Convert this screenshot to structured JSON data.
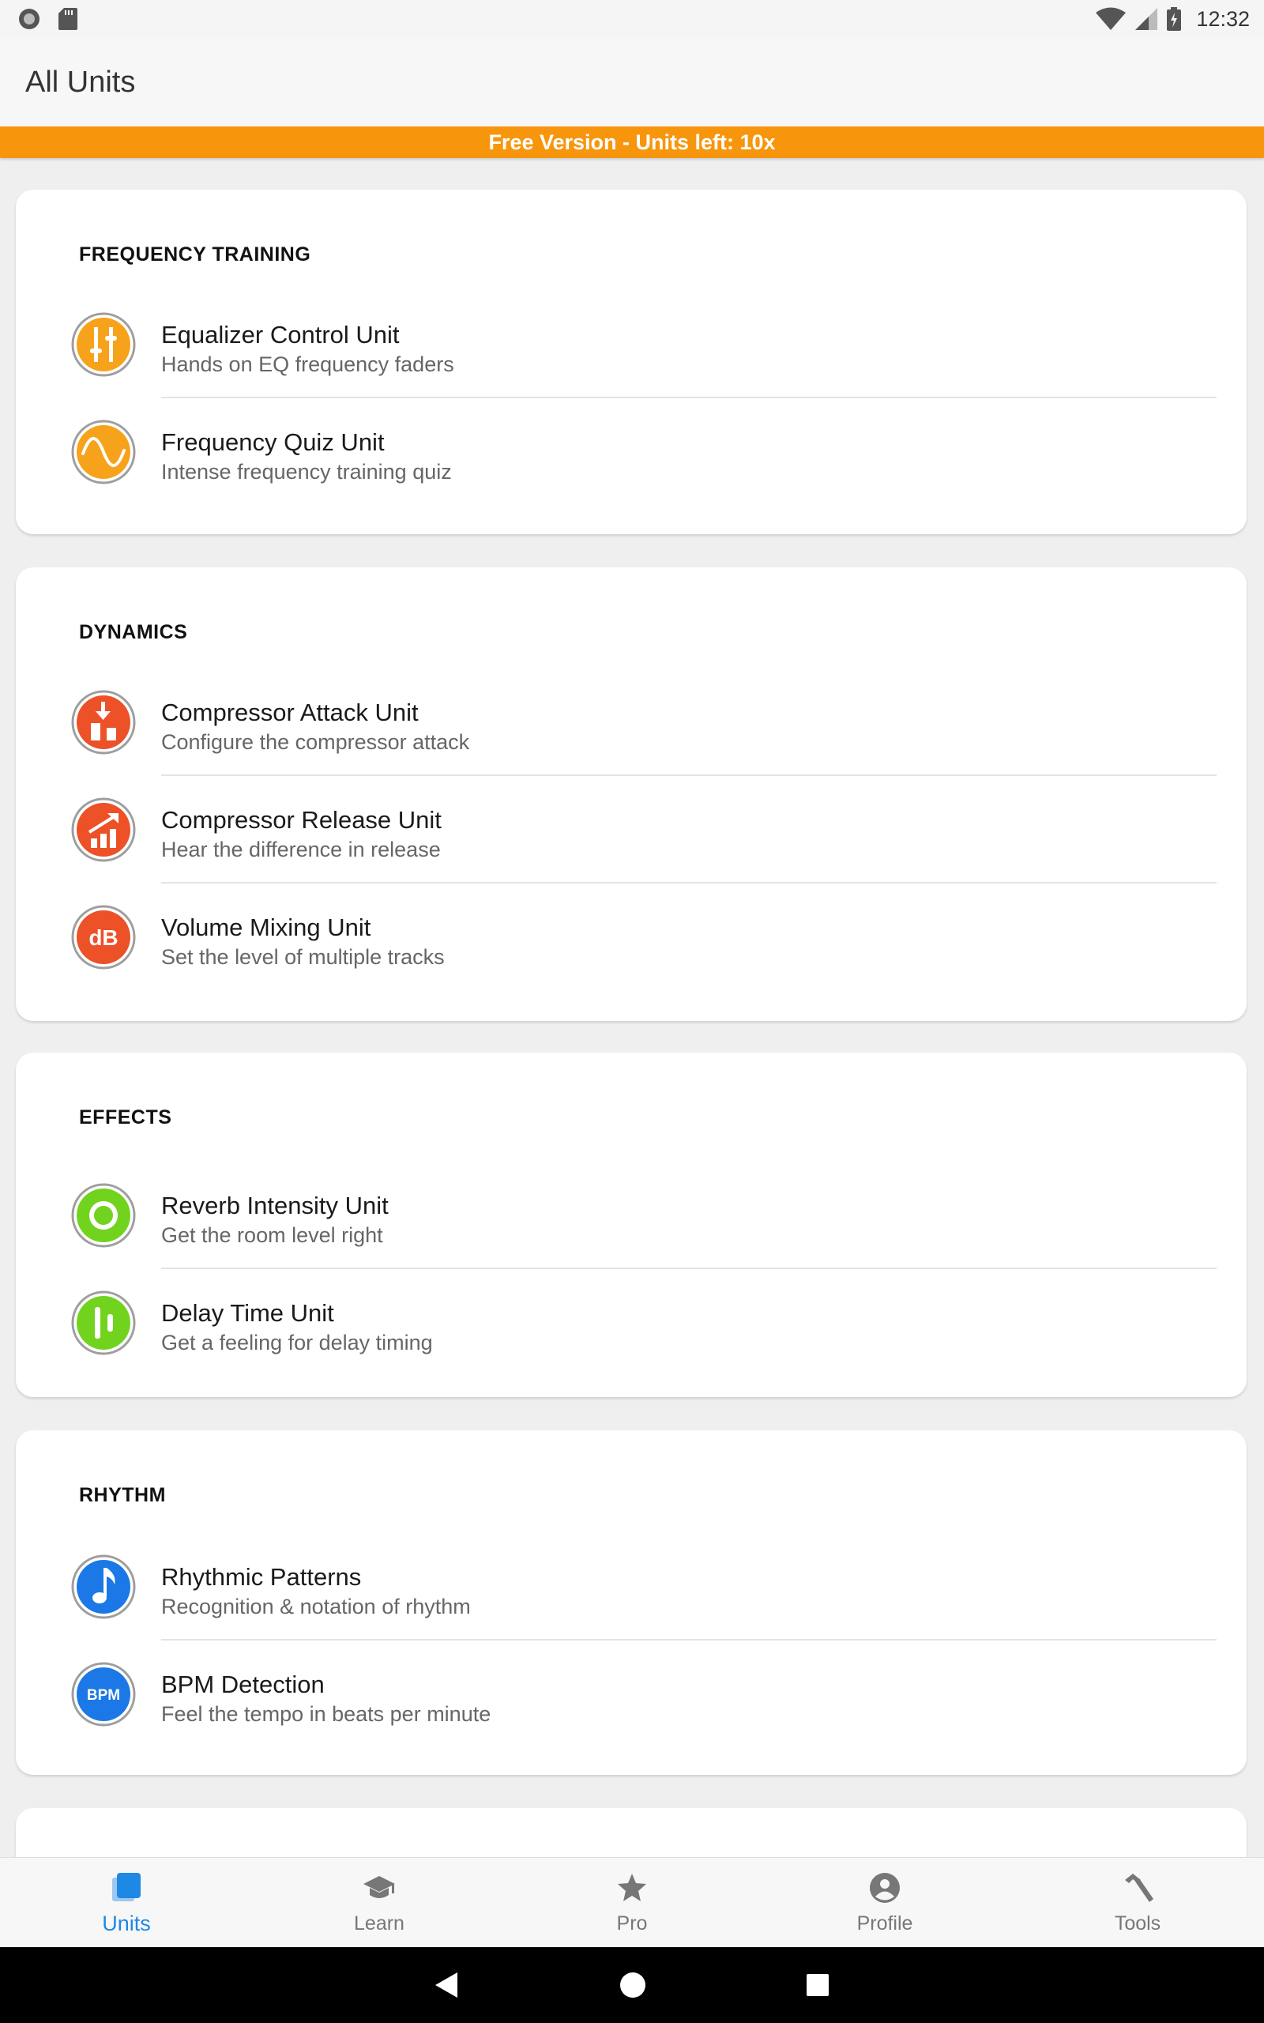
{
  "status_bar": {
    "time": "12:32"
  },
  "app_bar": {
    "title": "All Units"
  },
  "banner": {
    "text": "Free Version - Units left: 10x"
  },
  "colors": {
    "orange": "#f7a21b",
    "red": "#ec5128",
    "green": "#72d31e",
    "blue": "#1b78e6",
    "accent": "#1e88e5",
    "banner": "#f7960c"
  },
  "sections": [
    {
      "title": "FREQUENCY TRAINING",
      "units": [
        {
          "title": "Equalizer Control Unit",
          "subtitle": "Hands on EQ frequency faders",
          "icon": "sliders-icon"
        },
        {
          "title": "Frequency Quiz Unit",
          "subtitle": "Intense frequency training quiz",
          "icon": "sine-wave-icon"
        }
      ]
    },
    {
      "title": "DYNAMICS",
      "units": [
        {
          "title": "Compressor Attack Unit",
          "subtitle": "Configure the compressor attack",
          "icon": "attack-icon"
        },
        {
          "title": "Compressor Release Unit",
          "subtitle": "Hear the difference in release",
          "icon": "release-icon"
        },
        {
          "title": "Volume Mixing Unit",
          "subtitle": "Set the level of multiple tracks",
          "icon": "db-icon",
          "icon_text": "dB"
        }
      ]
    },
    {
      "title": "EFFECTS",
      "units": [
        {
          "title": "Reverb Intensity Unit",
          "subtitle": "Get the room level right",
          "icon": "ring-icon"
        },
        {
          "title": "Delay Time Unit",
          "subtitle": "Get a feeling for delay timing",
          "icon": "delay-bars-icon"
        }
      ]
    },
    {
      "title": "RHYTHM",
      "units": [
        {
          "title": "Rhythmic Patterns",
          "subtitle": "Recognition & notation of rhythm",
          "icon": "music-note-icon"
        },
        {
          "title": "BPM Detection",
          "subtitle": "Feel the tempo in beats per minute",
          "icon": "bpm-icon",
          "icon_text": "BPM"
        }
      ]
    }
  ],
  "bottom_nav": [
    {
      "label": "Units",
      "icon": "units-icon",
      "active": true
    },
    {
      "label": "Learn",
      "icon": "graduation-cap-icon"
    },
    {
      "label": "Pro",
      "icon": "star-icon"
    },
    {
      "label": "Profile",
      "icon": "account-circle-icon"
    },
    {
      "label": "Tools",
      "icon": "hammer-icon"
    }
  ]
}
